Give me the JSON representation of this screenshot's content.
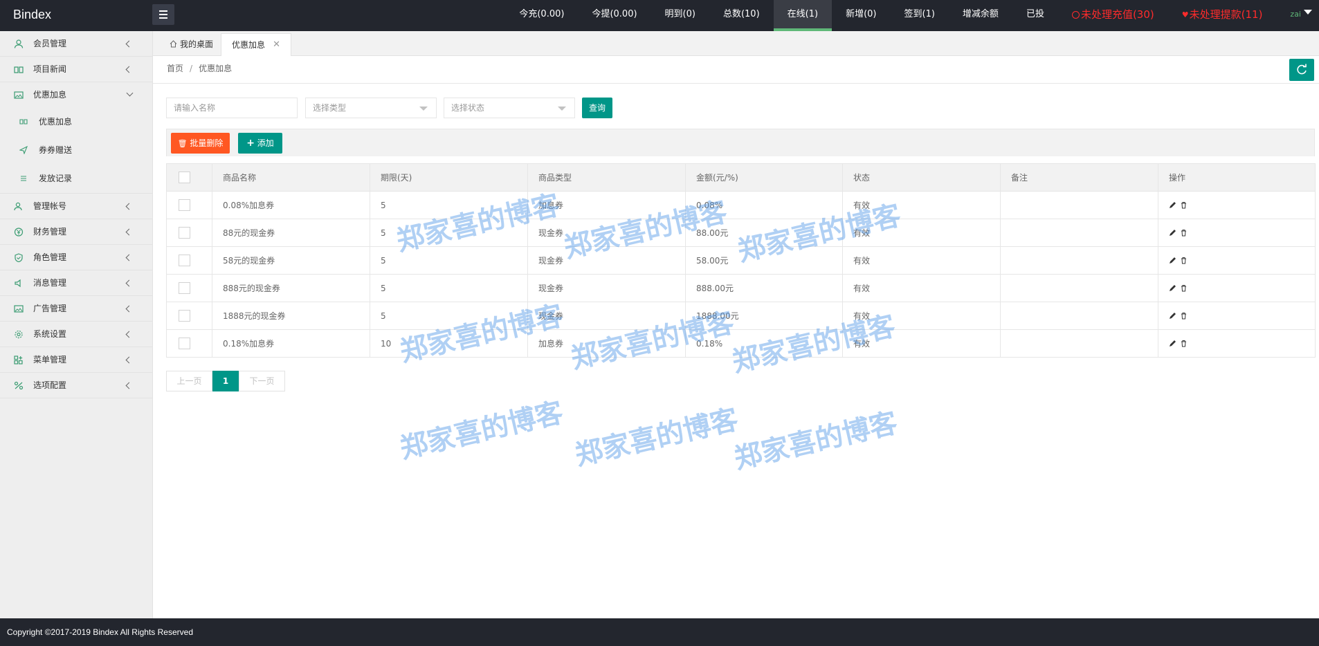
{
  "header": {
    "logo": "Bindex",
    "nav": [
      {
        "label": "今充(0.00)"
      },
      {
        "label": "今提(0.00)"
      },
      {
        "label": "明到(0)"
      },
      {
        "label": "总数(10)"
      },
      {
        "label": "在线(1)"
      },
      {
        "label": "新增(0)"
      },
      {
        "label": "签到(1)"
      },
      {
        "label": "增减余额"
      },
      {
        "label": "已投"
      }
    ],
    "alerts": [
      {
        "label": "未处理充值(30)"
      },
      {
        "label": "未处理提款(11)"
      }
    ],
    "user": "zai"
  },
  "sidebar": {
    "items": [
      {
        "label": "会员管理",
        "icon": "user-icon"
      },
      {
        "label": "项目新闻",
        "icon": "book-icon"
      },
      {
        "label": "优惠加息",
        "icon": "image-icon"
      }
    ],
    "sub_items": [
      {
        "label": "优惠加息",
        "icon": "book-icon"
      },
      {
        "label": "券券赠送",
        "icon": "send-icon"
      },
      {
        "label": "发放记录",
        "icon": "list-icon"
      }
    ],
    "items_after": [
      {
        "label": "管理帐号",
        "icon": "users-icon"
      },
      {
        "label": "财务管理",
        "icon": "yen-icon"
      },
      {
        "label": "角色管理",
        "icon": "shield-icon"
      },
      {
        "label": "消息管理",
        "icon": "speaker-icon"
      },
      {
        "label": "广告管理",
        "icon": "picture-icon"
      },
      {
        "label": "系统设置",
        "icon": "gear-icon"
      },
      {
        "label": "菜单管理",
        "icon": "grid-icon"
      },
      {
        "label": "选项配置",
        "icon": "options-icon"
      }
    ]
  },
  "tabs": {
    "home": "我的桌面",
    "active": "优惠加息"
  },
  "breadcrumb": {
    "home": "首页",
    "sep": "/",
    "current": "优惠加息"
  },
  "search": {
    "name_placeholder": "请输入名称",
    "type_placeholder": "选择类型",
    "status_placeholder": "选择状态",
    "query_label": "查询"
  },
  "toolbar": {
    "batch_delete_label": "批量删除",
    "add_label": "添加"
  },
  "table": {
    "headers": [
      "商品名称",
      "期限(天)",
      "商品类型",
      "金额(元/%)",
      "状态",
      "备注",
      "操作"
    ],
    "rows": [
      {
        "name": "0.08%加息券",
        "term": "5",
        "type": "加息券",
        "amount": "0.08%",
        "status": "有效",
        "note": ""
      },
      {
        "name": "88元的现金券",
        "term": "5",
        "type": "现金券",
        "amount": "88.00元",
        "status": "有效",
        "note": ""
      },
      {
        "name": "58元的现金券",
        "term": "5",
        "type": "现金券",
        "amount": "58.00元",
        "status": "有效",
        "note": ""
      },
      {
        "name": "888元的现金券",
        "term": "5",
        "type": "现金券",
        "amount": "888.00元",
        "status": "有效",
        "note": ""
      },
      {
        "name": "1888元的现金券",
        "term": "5",
        "type": "现金券",
        "amount": "1888.00元",
        "status": "有效",
        "note": ""
      },
      {
        "name": "0.18%加息券",
        "term": "10",
        "type": "加息券",
        "amount": "0.18%",
        "status": "有效",
        "note": ""
      }
    ]
  },
  "pagination": {
    "prev": "上一页",
    "current": "1",
    "next": "下一页"
  },
  "watermark": "郑家喜的博客",
  "footer": "Copyright ©2017-2019 Bindex All Rights Reserved",
  "colors": {
    "header_bg": "#23262e",
    "accent": "#009688",
    "danger": "#ff5722",
    "alert_red": "#ff2b2b",
    "active_nav_bar": "#5fb878"
  }
}
